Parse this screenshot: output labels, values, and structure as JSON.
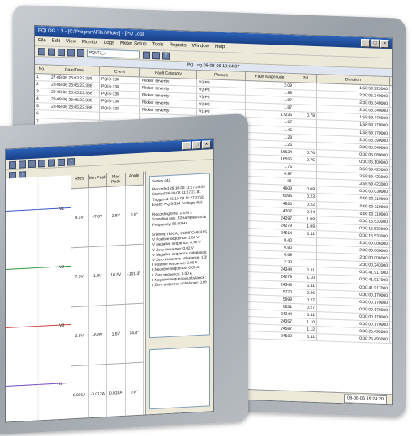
{
  "back_window": {
    "title": "PQLOG 1.3 - [C:\\Program\\Files\\Fluke] - [PQ Log]",
    "menu": [
      "File",
      "Edit",
      "View",
      "Monitor",
      "Logs",
      "Meter Setup",
      "Tools",
      "Reports",
      "Window",
      "Help"
    ],
    "toolbar_select": "PQLT3_1",
    "sub_title": "PQ Log   08-08-06 19:24:07",
    "columns": [
      "No.",
      "Date/Time",
      "Event",
      "Fault Category",
      "Phases",
      "Fault Magnitude",
      "PU",
      "Duration"
    ],
    "rows": [
      {
        "no": "1",
        "date": "27-08-06 23:03:23.288",
        "event": "PQIS-138",
        "cat": "Flicker severity",
        "phase": "V2 P/t",
        "mag": "2.09",
        "pu": "",
        "dur": "1:58:59.223000"
      },
      {
        "no": "2",
        "date": "28-08-06 23:05:23.388",
        "event": "PQIS-138",
        "cat": "Flicker severity",
        "phase": "V2 P/t",
        "mag": "1.99",
        "pu": "",
        "dur": "2:00:06.340000"
      },
      {
        "no": "3",
        "date": "28-08-06 23:05:23.388",
        "event": "PQIS-138",
        "cat": "Flicker severity",
        "phase": "V3 P/t",
        "mag": "1.87",
        "pu": "",
        "dur": "2:00:06.340000"
      },
      {
        "no": "4",
        "date": "28-08-06 23:05:23.388",
        "event": "PQIS-138",
        "cat": "Flicker severity",
        "phase": "V3 P/t",
        "mag": "1.87",
        "pu": "",
        "dur": "2:00:06.340000"
      },
      {
        "no": "5",
        "date": "28-08-06 23:05:23.388",
        "event": "PQIS-138",
        "cat": "Flicker severity",
        "phase": "V1 P/t",
        "mag": "17235",
        "pu": "0.78",
        "dur": "1:58:59.770000"
      },
      {
        "no": "6",
        "date": "",
        "event": "",
        "cat": "",
        "phase": "",
        "mag": "1.67",
        "pu": "",
        "dur": "1:58:59.770000"
      },
      {
        "no": "7",
        "date": "",
        "event": "",
        "cat": "",
        "phase": "",
        "mag": "1.45",
        "pu": "",
        "dur": "1:58:59.770000"
      },
      {
        "no": "8",
        "date": "",
        "event": "",
        "cat": "",
        "phase": "",
        "mag": "1.28",
        "pu": "",
        "dur": "2:00:03.390000"
      },
      {
        "no": "9",
        "date": "",
        "event": "",
        "cat": "",
        "phase": "",
        "mag": "1.26",
        "pu": "",
        "dur": "2:00:06.340000"
      },
      {
        "no": "10",
        "date": "",
        "event": "",
        "cat": "",
        "phase": "",
        "mag": "16634",
        "pu": "0.76",
        "dur": "0:00:06.080000"
      },
      {
        "no": "11",
        "date": "",
        "event": "",
        "cat": "",
        "phase": "",
        "mag": "16555",
        "pu": "0.75",
        "dur": "0:00:06.100000"
      },
      {
        "no": "12",
        "date": "",
        "event": "",
        "cat": "",
        "phase": "",
        "mag": "1.75",
        "pu": "",
        "dur": "3:59:59.423000"
      },
      {
        "no": "13",
        "date": "",
        "event": "",
        "cat": "",
        "phase": "",
        "mag": "4.97",
        "pu": "",
        "dur": "3:59:59.423000"
      },
      {
        "no": "14",
        "date": "",
        "event": "",
        "cat": "",
        "phase": "",
        "mag": "1.81",
        "pu": "",
        "dur": "3:59:59.423000"
      },
      {
        "no": "15",
        "date": "",
        "event": "",
        "cat": "",
        "phase": "",
        "mag": "4608",
        "pu": "0.09",
        "dur": "0:00:00.030000"
      },
      {
        "no": "16",
        "date": "",
        "event": "",
        "cat": "",
        "phase": "",
        "mag": "6096",
        "pu": "0.23",
        "dur": "0:00:00.110000"
      },
      {
        "no": "17",
        "date": "",
        "event": "",
        "cat": "",
        "phase": "",
        "mag": "4930",
        "pu": "0.22",
        "dur": "0:00:00.110000"
      },
      {
        "no": "18",
        "date": "",
        "event": "",
        "cat": "",
        "phase": "",
        "mag": "4707",
        "pu": "0.24",
        "dur": "0:00:00.110000"
      },
      {
        "no": "19",
        "date": "",
        "event": "",
        "cat": "",
        "phase": "",
        "mag": "24297",
        "pu": "1.09",
        "dur": "0:00:15.533000"
      },
      {
        "no": "20",
        "date": "",
        "event": "",
        "cat": "",
        "phase": "",
        "mag": "24279",
        "pu": "1.09",
        "dur": "0:00:15.533000"
      },
      {
        "no": "21",
        "date": "",
        "event": "",
        "cat": "",
        "phase": "",
        "mag": "24514",
        "pu": "1.11",
        "dur": "0:00:15.533000"
      },
      {
        "no": "22",
        "date": "",
        "event": "",
        "cat": "",
        "phase": "",
        "mag": "0.40",
        "pu": "",
        "dur": "2:00:00.006000"
      },
      {
        "no": "23",
        "date": "",
        "event": "",
        "cat": "",
        "phase": "",
        "mag": "0.80",
        "pu": "",
        "dur": "2:00:00.006000"
      },
      {
        "no": "24",
        "date": "",
        "event": "",
        "cat": "",
        "phase": "",
        "mag": "0.69",
        "pu": "",
        "dur": "2:00:00.006000"
      },
      {
        "no": "25",
        "date": "",
        "event": "",
        "cat": "",
        "phase": "",
        "mag": "2.33",
        "pu": "",
        "dur": "2:00:00.243000"
      },
      {
        "no": "26",
        "date": "",
        "event": "",
        "cat": "",
        "phase": "",
        "mag": "24344",
        "pu": "1.11",
        "dur": "0:00:41.917000"
      },
      {
        "no": "27",
        "date": "",
        "event": "",
        "cat": "",
        "phase": "",
        "mag": "24279",
        "pu": "1.10",
        "dur": "0:00:41.917000"
      },
      {
        "no": "28",
        "date": "",
        "event": "",
        "cat": "",
        "phase": "",
        "mag": "24343",
        "pu": "1.11",
        "dur": "0:00:41.917000"
      },
      {
        "no": "29",
        "date": "",
        "event": "",
        "cat": "",
        "phase": "",
        "mag": "5770",
        "pu": "0.26",
        "dur": "0:00:00.170000"
      },
      {
        "no": "30",
        "date": "",
        "event": "",
        "cat": "",
        "phase": "",
        "mag": "5999",
        "pu": "0.27",
        "dur": "0:00:00.170000"
      },
      {
        "no": "31",
        "date": "",
        "event": "",
        "cat": "",
        "phase": "",
        "mag": "6831",
        "pu": "0.27",
        "dur": "0:00:00.170000"
      },
      {
        "no": "32",
        "date": "",
        "event": "",
        "cat": "",
        "phase": "",
        "mag": "24344",
        "pu": "1.11",
        "dur": "0:00:00.170000"
      },
      {
        "no": "33",
        "date": "",
        "event": "",
        "cat": "",
        "phase": "",
        "mag": "24357",
        "pu": "1.10",
        "dur": "0:00:00.170000"
      },
      {
        "no": "34",
        "date": "",
        "event": "",
        "cat": "",
        "phase": "",
        "mag": "24587",
        "pu": "1.12",
        "dur": "0:00:25.493000"
      },
      {
        "no": "35",
        "date": "",
        "event": "",
        "cat": "",
        "phase": "",
        "mag": "24582",
        "pu": "1.11",
        "dur": "0:00:25.493000"
      }
    ],
    "status_time": "08-08-06 19:24:20"
  },
  "front_window": {
    "meas_headers": [
      "RMS",
      "Min Peak",
      "Max Peak",
      "Angle"
    ],
    "meas_rows": [
      {
        "ch": "V1",
        "rms": "4.5V",
        "min": "-7.6V",
        "max": "2.8V",
        "ang": "0.0°"
      },
      {
        "ch": "V2",
        "rms": "7.0V",
        "min": "1.8V",
        "max": "10.3V",
        "ang": "-101.3°"
      },
      {
        "ch": "V3",
        "rms": "2.8V",
        "min": "-6.8V",
        "max": "1.6V",
        "ang": "74.8°"
      },
      {
        "ch": "I1",
        "rms": "0.001A",
        "min": "-0.012A",
        "max": "0.018A",
        "ang": "0.0°"
      }
    ],
    "series_title": "Series #42",
    "info_lines": [
      "Recorded 26-10-08 11:27:25.09",
      "Started  26-10-08 11:27:27.81",
      "Triggered 26-10-08 11:27:27.81",
      "Event: PQIS-324 (Voltage dip)",
      "",
      "Recording time: 2.376 s",
      "Sampling rate: 32 samples/cycle",
      "Frequency: 50.00 Hz",
      "",
      "SYMMETRICAL COMPONENTS",
      "V Positive sequence: 1.60 V",
      "V Negative sequence: 0.70 V",
      "V Zero sequence: 0.02 V",
      "V Negative sequence unbalance:",
      "V Zero sequence unbalance: 1.3%",
      "I Positive sequence: 0.00 A",
      "I Negative sequence: 0.00 A",
      "I Zero sequence: 0.00 A",
      "I Negative sequence unbalance: 1",
      "I Zero sequence unbalance: 0.0%"
    ],
    "wave_colors": [
      "#3b58c8",
      "#2e9a3a",
      "#c8453b",
      "#7a4cc0"
    ]
  },
  "icons": {
    "min": "minimize-icon",
    "max": "maximize-icon",
    "close": "close-icon"
  }
}
